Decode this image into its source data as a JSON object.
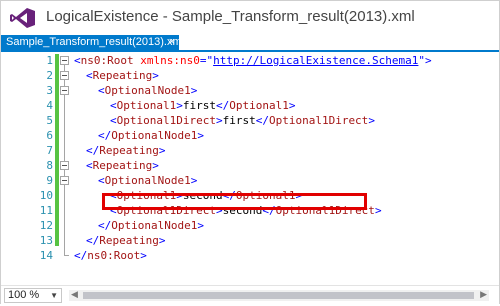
{
  "window": {
    "title": "LogicalExistence - Sample_Transform_result(2013).xml"
  },
  "tab": {
    "label": "Sample_Transform_result(2013).xml",
    "close_glyph": "×"
  },
  "editor": {
    "lines": [
      {
        "num": "1",
        "indent": 0,
        "parts": [
          {
            "cls": "br",
            "t": "<"
          },
          {
            "cls": "tag",
            "t": "ns0:Root"
          },
          {
            "cls": "attr",
            "t": " xmlns:ns0"
          },
          {
            "cls": "br",
            "t": "="
          },
          {
            "cls": "val",
            "t": "\""
          },
          {
            "cls": "link",
            "t": "http://LogicalExistence.Schema1"
          },
          {
            "cls": "val",
            "t": "\""
          },
          {
            "cls": "br",
            "t": ">"
          }
        ]
      },
      {
        "num": "2",
        "indent": 1,
        "parts": [
          {
            "cls": "br",
            "t": "<"
          },
          {
            "cls": "tag",
            "t": "Repeating"
          },
          {
            "cls": "br",
            "t": ">"
          }
        ]
      },
      {
        "num": "3",
        "indent": 2,
        "parts": [
          {
            "cls": "br",
            "t": "<"
          },
          {
            "cls": "tag",
            "t": "OptionalNode1"
          },
          {
            "cls": "br",
            "t": ">"
          }
        ]
      },
      {
        "num": "4",
        "indent": 3,
        "parts": [
          {
            "cls": "br",
            "t": "<"
          },
          {
            "cls": "tag",
            "t": "Optional1"
          },
          {
            "cls": "br",
            "t": ">"
          },
          {
            "cls": "text",
            "t": "first"
          },
          {
            "cls": "br",
            "t": "</"
          },
          {
            "cls": "tag",
            "t": "Optional1"
          },
          {
            "cls": "br",
            "t": ">"
          }
        ]
      },
      {
        "num": "5",
        "indent": 3,
        "parts": [
          {
            "cls": "br",
            "t": "<"
          },
          {
            "cls": "tag",
            "t": "Optional1Direct"
          },
          {
            "cls": "br",
            "t": ">"
          },
          {
            "cls": "text",
            "t": "first"
          },
          {
            "cls": "br",
            "t": "</"
          },
          {
            "cls": "tag",
            "t": "Optional1Direct"
          },
          {
            "cls": "br",
            "t": ">"
          }
        ]
      },
      {
        "num": "6",
        "indent": 2,
        "parts": [
          {
            "cls": "br",
            "t": "</"
          },
          {
            "cls": "tag",
            "t": "OptionalNode1"
          },
          {
            "cls": "br",
            "t": ">"
          }
        ]
      },
      {
        "num": "7",
        "indent": 1,
        "parts": [
          {
            "cls": "br",
            "t": "</"
          },
          {
            "cls": "tag",
            "t": "Repeating"
          },
          {
            "cls": "br",
            "t": ">"
          }
        ]
      },
      {
        "num": "8",
        "indent": 1,
        "parts": [
          {
            "cls": "br",
            "t": "<"
          },
          {
            "cls": "tag",
            "t": "Repeating"
          },
          {
            "cls": "br",
            "t": ">"
          }
        ]
      },
      {
        "num": "9",
        "indent": 2,
        "parts": [
          {
            "cls": "br",
            "t": "<"
          },
          {
            "cls": "tag",
            "t": "OptionalNode1"
          },
          {
            "cls": "br",
            "t": ">"
          }
        ]
      },
      {
        "num": "10",
        "indent": 3,
        "parts": [
          {
            "cls": "br",
            "t": "<"
          },
          {
            "cls": "tag",
            "t": "Optional1"
          },
          {
            "cls": "br",
            "t": ">"
          },
          {
            "cls": "text",
            "t": "second"
          },
          {
            "cls": "br",
            "t": "</"
          },
          {
            "cls": "tag",
            "t": "Optional1"
          },
          {
            "cls": "br",
            "t": ">"
          }
        ]
      },
      {
        "num": "11",
        "indent": 3,
        "parts": [
          {
            "cls": "br",
            "t": "<"
          },
          {
            "cls": "tag",
            "t": "Optional1Direct"
          },
          {
            "cls": "br",
            "t": ">"
          },
          {
            "cls": "text",
            "t": "second"
          },
          {
            "cls": "br",
            "t": "</"
          },
          {
            "cls": "tag",
            "t": "Optional1Direct"
          },
          {
            "cls": "br",
            "t": ">"
          }
        ]
      },
      {
        "num": "12",
        "indent": 2,
        "parts": [
          {
            "cls": "br",
            "t": "</"
          },
          {
            "cls": "tag",
            "t": "OptionalNode1"
          },
          {
            "cls": "br",
            "t": ">"
          }
        ]
      },
      {
        "num": "13",
        "indent": 1,
        "parts": [
          {
            "cls": "br",
            "t": "</"
          },
          {
            "cls": "tag",
            "t": "Repeating"
          },
          {
            "cls": "br",
            "t": ">"
          }
        ]
      },
      {
        "num": "14",
        "indent": 0,
        "parts": [
          {
            "cls": "br",
            "t": "</"
          },
          {
            "cls": "tag",
            "t": "ns0:Root"
          },
          {
            "cls": "br",
            "t": ">"
          }
        ]
      }
    ],
    "highlighted_line": "11"
  },
  "statusbar": {
    "zoom": "100 %",
    "zoom_arrow": "▼",
    "scroll_left": "◀",
    "scroll_right": "▶"
  },
  "colors": {
    "accent": "#007acc",
    "highlight": "#e10000",
    "changebar": "#57c342"
  }
}
